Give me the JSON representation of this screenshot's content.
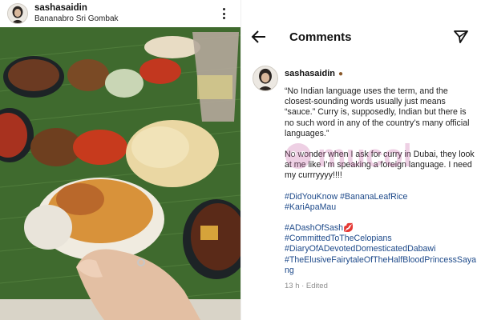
{
  "post": {
    "username": "sashasaidin",
    "location": "Bananabro Sri Gombak",
    "more_icon": "more-vertical-icon"
  },
  "comments_panel": {
    "title": "Comments",
    "back_icon": "arrow-left-icon",
    "send_icon": "send-icon"
  },
  "comment": {
    "username": "sashasaidin",
    "emoji": "●",
    "paragraph_1": "“No Indian language uses the term, and the closest-sounding words usually just means “sauce.” Curry is, supposedly, Indian but there is no such word in any of the country’s many official languages.”",
    "paragraph_2": "No wonder when I ask for curry in Dubai, they look at me like I’m speaking a foreign language. I need my currryyyy!!!!",
    "hashtags_1": [
      "#DidYouKnow",
      "#BananaLeafRice",
      "#KariApaMau"
    ],
    "hashtags_2": [
      "#ADashOfSash",
      "#CommittedToTheCelopians",
      "#DiaryOfADevotedDomesticatedDabawi",
      "#TheElusiveFairytaleOfTheHalfBloodPrincessSayang"
    ],
    "lips_emoji": "💋",
    "meta": "13 h · Edited"
  },
  "watermark": {
    "text": "mucol"
  },
  "colors": {
    "hashtag": "#1e4a8a",
    "banana_leaf": "#3f6a2e",
    "meta": "#8e8e8e"
  }
}
